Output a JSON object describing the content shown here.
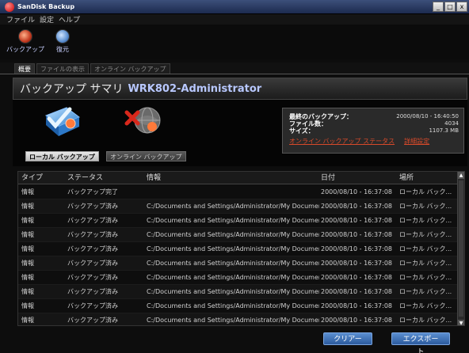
{
  "window": {
    "title": "SanDisk Backup",
    "controls": [
      "_",
      "□",
      "x"
    ]
  },
  "menu": [
    "ファイル",
    "設定",
    "ヘルプ"
  ],
  "toolbar": {
    "backup_label": "バックアップ",
    "restore_label": "復元"
  },
  "tabs": [
    {
      "label": "概要",
      "active": true
    },
    {
      "label": "ファイルの表示",
      "active": false
    },
    {
      "label": "オンライン バックアップ",
      "active": false
    }
  ],
  "summary": {
    "title": "バックアップ サマリ",
    "computer": "WRK802-Administrator",
    "local_button": "ローカル バックアップ",
    "online_button": "オンライン バックアップ",
    "info": {
      "last_backup_label": "最終のバックアップ：",
      "last_backup_value": "2000/08/10 - 16:40:50",
      "files_label": "ファイル数：",
      "files_value": "4034",
      "size_label": "サイズ：",
      "size_value": "1107.3 MB",
      "link_status": "オンライン バックアップ ステータス",
      "link_detail": "詳細設定"
    }
  },
  "table": {
    "columns": [
      "タイプ",
      "ステータス",
      "情報",
      "日付",
      "場所"
    ],
    "rows": [
      [
        "情報",
        "バックアップ完了",
        "",
        "2000/08/10 - 16:37:08",
        "ローカル バック..."
      ],
      [
        "情報",
        "バックアップ済み",
        "C:/Documents and Settings/Administrator/My Documents/...",
        "2000/08/10 - 16:37:08",
        "ローカル バック..."
      ],
      [
        "情報",
        "バックアップ済み",
        "C:/Documents and Settings/Administrator/My Documents/...",
        "2000/08/10 - 16:37:08",
        "ローカル バック..."
      ],
      [
        "情報",
        "バックアップ済み",
        "C:/Documents and Settings/Administrator/My Documents/...",
        "2000/08/10 - 16:37:08",
        "ローカル バック..."
      ],
      [
        "情報",
        "バックアップ済み",
        "C:/Documents and Settings/Administrator/My Documents/...",
        "2000/08/10 - 16:37:08",
        "ローカル バック..."
      ],
      [
        "情報",
        "バックアップ済み",
        "C:/Documents and Settings/Administrator/My Documents/...",
        "2000/08/10 - 16:37:08",
        "ローカル バック..."
      ],
      [
        "情報",
        "バックアップ済み",
        "C:/Documents and Settings/Administrator/My Documents/...",
        "2000/08/10 - 16:37:08",
        "ローカル バック..."
      ],
      [
        "情報",
        "バックアップ済み",
        "C:/Documents and Settings/Administrator/My Documents/...",
        "2000/08/10 - 16:37:08",
        "ローカル バック..."
      ],
      [
        "情報",
        "バックアップ済み",
        "C:/Documents and Settings/Administrator/My Documents/...",
        "2000/08/10 - 16:37:08",
        "ローカル バック..."
      ],
      [
        "情報",
        "バックアップ済み",
        "C:/Documents and Settings/Administrator/My Documents/...",
        "2000/08/10 - 16:37:08",
        "ローカル バック..."
      ]
    ]
  },
  "buttons": {
    "clear": "クリアー",
    "export": "エクスポート"
  },
  "colors": {
    "accent_link": "#d84a2a",
    "button_blue": "#2c5b9e",
    "computer_name": "#b8c8ff"
  }
}
